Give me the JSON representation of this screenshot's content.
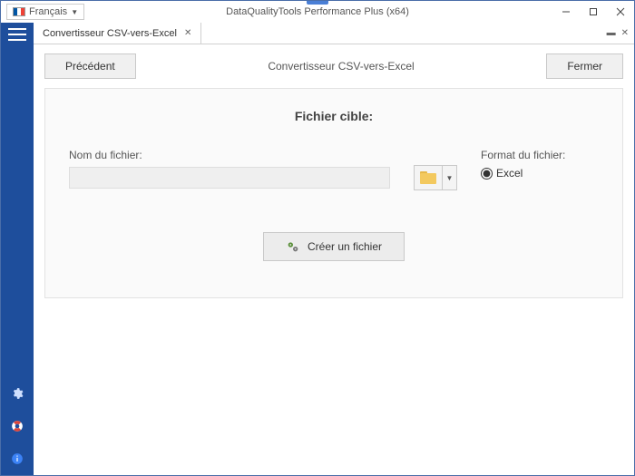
{
  "titlebar": {
    "language_label": "Français",
    "app_title": "DataQualityTools Performance Plus (x64)"
  },
  "tab": {
    "label": "Convertisseur CSV-vers-Excel"
  },
  "actions": {
    "back_label": "Précédent",
    "breadcrumb": "Convertisseur CSV-vers-Excel",
    "close_label": "Fermer"
  },
  "panel": {
    "title": "Fichier cible:",
    "filename_label": "Nom du fichier:",
    "filename_value": "",
    "format_label": "Format du fichier:",
    "format_option_excel": "Excel",
    "create_label": "Créer un fichier"
  }
}
